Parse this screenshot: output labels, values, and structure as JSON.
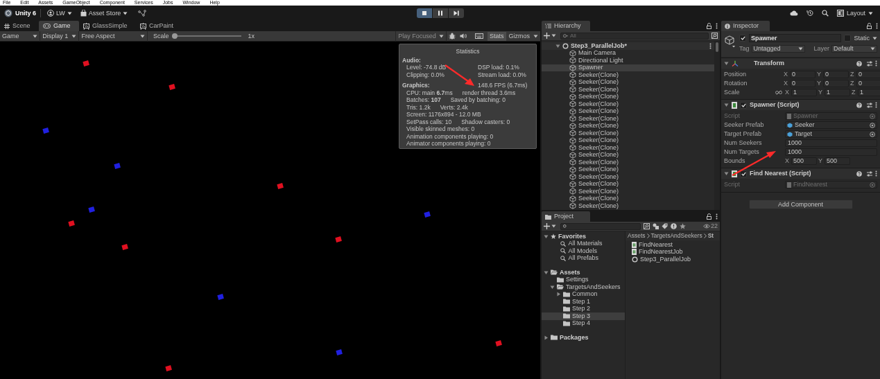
{
  "menu_bar": [
    "File",
    "Edit",
    "Assets",
    "GameObject",
    "Component",
    "Services",
    "Jobs",
    "Window",
    "Help"
  ],
  "toolbar": {
    "product": "Unity 6",
    "account": "LW",
    "store": "Asset Store",
    "layout": "Layout"
  },
  "play_controls": [
    {
      "kind": "play",
      "on": true
    },
    {
      "kind": "pause",
      "on": false
    },
    {
      "kind": "step",
      "on": false
    }
  ],
  "view_tabs": [
    {
      "label": "Scene",
      "kind": "scene",
      "selected": false
    },
    {
      "label": "Game",
      "kind": "game",
      "selected": true
    },
    {
      "label": "GlassSimple",
      "kind": "shader",
      "selected": false
    },
    {
      "label": "CarPaint",
      "kind": "shader",
      "selected": false
    }
  ],
  "game_toolbar": {
    "mode": "Game",
    "display": "Display 1",
    "aspect": "Free Aspect",
    "scale": {
      "label": "Scale",
      "level": 0,
      "reading": "1x"
    },
    "play_mode": "Play Focused",
    "stats": "Stats",
    "stats_on": true,
    "gizmos": "Gizmos"
  },
  "statistics": {
    "title": "Statistics",
    "audio": {
      "heading": "Audio:",
      "left": [
        "Level: -74.8 dB",
        "Clipping: 0.0%"
      ],
      "right": [
        "DSP load: 0.1%",
        "Stream load: 0.0%"
      ]
    },
    "graphics": {
      "heading": "Graphics:",
      "fps": "148.6 FPS (6.7ms)",
      "lines": [
        [
          "CPU: main **6.7**ms",
          "render thread 3.6ms"
        ],
        [
          "Batches: **107**",
          "Saved by batching: 0"
        ],
        [
          "Tris: 1.2k",
          "Verts: 2.4k"
        ],
        [
          "Screen: 1176x894 - 12.0 MB"
        ],
        [
          "SetPass calls: 10",
          "Shadow casters: 0"
        ],
        [
          "Visible skinned meshes: 0"
        ],
        [
          "Animation components playing: 0"
        ],
        [
          "Animator components playing: 0"
        ]
      ]
    }
  },
  "hierarchy": {
    "title": "Hierarchy",
    "search_placeholder": "All",
    "scene": {
      "name": "Step3_ParallelJob*",
      "expanded": true,
      "children": [
        {
          "name": "Main Camera",
          "selected": false
        },
        {
          "name": "Directional Light",
          "selected": false
        },
        {
          "name": "Spawner",
          "selected": true
        },
        {
          "name": "Seeker(Clone)",
          "selected": false
        },
        {
          "name": "Seeker(Clone)",
          "selected": false
        },
        {
          "name": "Seeker(Clone)",
          "selected": false
        },
        {
          "name": "Seeker(Clone)",
          "selected": false
        },
        {
          "name": "Seeker(Clone)",
          "selected": false
        },
        {
          "name": "Seeker(Clone)",
          "selected": false
        },
        {
          "name": "Seeker(Clone)",
          "selected": false
        },
        {
          "name": "Seeker(Clone)",
          "selected": false
        },
        {
          "name": "Seeker(Clone)",
          "selected": false
        },
        {
          "name": "Seeker(Clone)",
          "selected": false
        },
        {
          "name": "Seeker(Clone)",
          "selected": false
        },
        {
          "name": "Seeker(Clone)",
          "selected": false
        },
        {
          "name": "Seeker(Clone)",
          "selected": false
        },
        {
          "name": "Seeker(Clone)",
          "selected": false
        },
        {
          "name": "Seeker(Clone)",
          "selected": false
        },
        {
          "name": "Seeker(Clone)",
          "selected": false
        },
        {
          "name": "Seeker(Clone)",
          "selected": false
        },
        {
          "name": "Seeker(Clone)",
          "selected": false
        },
        {
          "name": "Seeker(Clone)",
          "selected": false
        }
      ]
    }
  },
  "project": {
    "title": "Project",
    "hidden_count": "22",
    "tree": [
      {
        "label": "Favorites",
        "kind": "favorites",
        "expanded": true,
        "selected": false,
        "children": [
          {
            "label": "All Materials",
            "kind": "search",
            "selected": false
          },
          {
            "label": "All Models",
            "kind": "search",
            "selected": false
          },
          {
            "label": "All Prefabs",
            "kind": "search",
            "selected": false
          }
        ]
      },
      {
        "label": "Assets",
        "kind": "folder",
        "expanded": true,
        "selected": false,
        "children": [
          {
            "label": "Settings",
            "kind": "folder",
            "selected": false
          },
          {
            "label": "TargetsAndSeekers",
            "kind": "folder",
            "expanded": true,
            "selected": false,
            "children": [
              {
                "label": "Common",
                "kind": "folder",
                "expanded": false,
                "selected": false
              },
              {
                "label": "Step 1",
                "kind": "folder",
                "selected": false
              },
              {
                "label": "Step 2",
                "kind": "folder",
                "selected": false
              },
              {
                "label": "Step 3",
                "kind": "folder",
                "selected": true
              },
              {
                "label": "Step 4",
                "kind": "folder",
                "selected": false
              }
            ]
          }
        ]
      },
      {
        "label": "Packages",
        "kind": "folder",
        "expanded": false,
        "selected": false
      }
    ],
    "breadcrumb": [
      "Assets",
      "TargetsAndSeekers",
      "St"
    ],
    "files": [
      {
        "name": "FindNearest",
        "kind": "script"
      },
      {
        "name": "FindNearestJob",
        "kind": "script"
      },
      {
        "name": "Step3_ParallelJob",
        "kind": "scene"
      }
    ]
  },
  "inspector": {
    "title": "Inspector",
    "object": {
      "active": true,
      "name": "Spawner",
      "static": false,
      "static_label": "Static",
      "tag_label": "Tag",
      "tag": "Untagged",
      "layer_label": "Layer",
      "layer": "Default"
    },
    "components": [
      {
        "title": "Transform",
        "kind": "transform",
        "expanded": true,
        "rows": [
          {
            "label": "Position",
            "kind": "vector3",
            "fields": [
              {
                "axis": "X",
                "value": "0"
              },
              {
                "axis": "Y",
                "value": "0"
              },
              {
                "axis": "Z",
                "value": "0"
              }
            ]
          },
          {
            "label": "Rotation",
            "kind": "vector3",
            "fields": [
              {
                "axis": "X",
                "value": "0"
              },
              {
                "axis": "Y",
                "value": "0"
              },
              {
                "axis": "Z",
                "value": "0"
              }
            ]
          },
          {
            "label": "Scale",
            "kind": "scale",
            "constrained": false,
            "fields": [
              {
                "axis": "X",
                "value": "1"
              },
              {
                "axis": "Y",
                "value": "1"
              },
              {
                "axis": "Z",
                "value": "1"
              }
            ]
          }
        ]
      },
      {
        "title": "Spawner (Script)",
        "kind": "script",
        "expanded": true,
        "enabled": true,
        "rows": [
          {
            "label": "Script",
            "kind": "script_ref",
            "disabled": true,
            "value": "Spawner"
          },
          {
            "label": "Seeker Prefab",
            "kind": "prefab_ref",
            "disabled": false,
            "value": "Seeker"
          },
          {
            "label": "Target Prefab",
            "kind": "prefab_ref",
            "disabled": false,
            "value": "Target"
          },
          {
            "label": "Num Seekers",
            "kind": "number",
            "disabled": false,
            "value": "1000"
          },
          {
            "label": "Num Targets",
            "kind": "number",
            "disabled": false,
            "value": "1000"
          },
          {
            "label": "Bounds",
            "kind": "vector2",
            "disabled": false,
            "fields": [
              {
                "axis": "X",
                "value": "500"
              },
              {
                "axis": "Y",
                "value": "500"
              }
            ]
          }
        ]
      },
      {
        "title": "Find Nearest (Script)",
        "kind": "script",
        "expanded": true,
        "enabled": true,
        "rows": [
          {
            "label": "Script",
            "kind": "script_ref",
            "disabled": true,
            "value": "FindNearest"
          }
        ]
      }
    ],
    "add_component": "Add Component"
  }
}
